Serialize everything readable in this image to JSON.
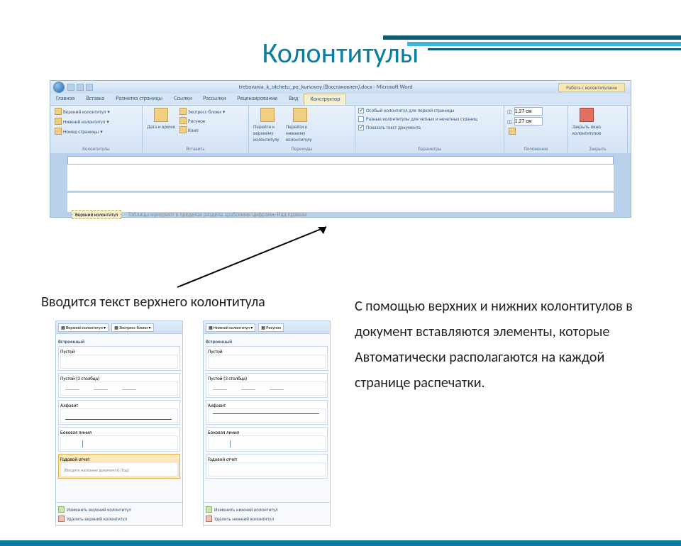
{
  "slide": {
    "title": "Колонтитулы"
  },
  "word": {
    "docTitle": "trebovania_k_otchetu_po_kursovoy (Восстановлен).docx - Microsoft Word",
    "ctxTitle": "Работа с колонтитулами",
    "tabs": [
      "Главная",
      "Вставка",
      "Разметка страницы",
      "Ссылки",
      "Рассылки",
      "Рецензирование",
      "Вид",
      "Конструктор"
    ],
    "ribbon": {
      "hf": {
        "label": "Колонтитулы",
        "topBtn": "Верхний колонтитул",
        "botBtn": "Нижний колонтитул",
        "pageNum": "Номер страницы"
      },
      "insert": {
        "label": "Вставить",
        "datetime": "Дата и время",
        "quick": "Экспресс-блоки",
        "pic": "Рисунок",
        "clip": "Клип"
      },
      "nav": {
        "label": "Переходы",
        "goTop": "Перейти к верхнему колонтитулу",
        "goBot": "Перейти к нижнему колонтитулу"
      },
      "opts": {
        "label": "Параметры",
        "o1": "Особый колонтитул для первой страницы",
        "o2": "Разные колонтитулы для четных и нечетных страниц",
        "o3": "Показать текст документа"
      },
      "pos": {
        "label": "Положение",
        "v1": "1,27 см",
        "v2": "1,27 см"
      },
      "close": {
        "label": "Закрыть",
        "btn": "Закрыть окно колонтитулов"
      }
    },
    "hfTag": "Верхний колонтитул",
    "hfText": "Таблицы нумеруют в пределах раздела арабскими цифрами. Над правым"
  },
  "captionLeft": "Вводится текст верхнего колонтитула",
  "bodyRight": "С помощью верхних и нижних колонтитулов в документ  вставляются элементы, которые Автоматически располагаются на каждой странице распечатки.",
  "gallery": {
    "headerBtn": "Верхний колонтитул",
    "footerBtn": "Нижний колонтитул",
    "quickBtn": "Экспресс-блоки",
    "picBtn": "Рисунок",
    "builtIn": "Встроенный",
    "items": {
      "blank": "Пустой",
      "blank3": "Пустой (3 столбца)",
      "alphabet": "Алфавит",
      "thinLine": "Боковая линия",
      "annual": "Годовой отчет"
    },
    "placeholder": "[Введите название документа]  [Год]",
    "footActions": {
      "editHeader": "Изменить верхний колонтитул",
      "removeHeader": "Удалить верхний колонтитул",
      "editFooter": "Изменить нижний колонтитул",
      "removeFooter": "Удалить нижний колонтитул"
    }
  }
}
